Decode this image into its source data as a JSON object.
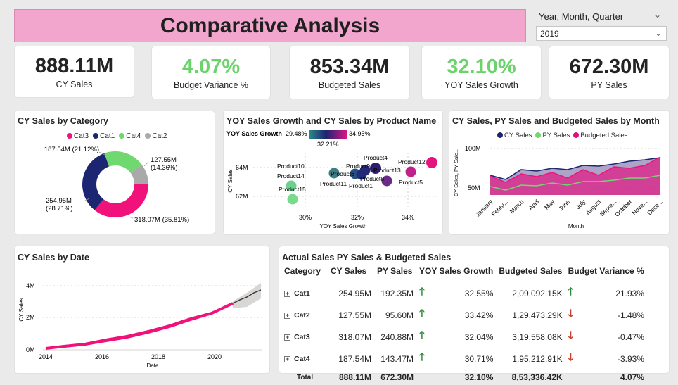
{
  "header": {
    "title": "Comparative Analysis"
  },
  "slicer": {
    "label": "Year, Month, Quarter",
    "value": "2019"
  },
  "kpis": [
    {
      "value": "888.11M",
      "label": "CY Sales"
    },
    {
      "value": "4.07%",
      "label": "Budget Variance %"
    },
    {
      "value": "853.34M",
      "label": "Budgeted Sales"
    },
    {
      "value": "32.10%",
      "label": "YOY Sales Growth"
    },
    {
      "value": "672.30M",
      "label": "PY Sales"
    }
  ],
  "colors": {
    "cat3": "#f0117a",
    "cat1": "#1c2571",
    "cat4": "#6fd86f",
    "cat2": "#a9a9a9",
    "accent": "#e73d8d",
    "up": "#2e8b3d",
    "down": "#c8402e"
  },
  "donut": {
    "title": "CY Sales by Category",
    "legend": [
      "Cat3",
      "Cat1",
      "Cat4",
      "Cat2"
    ],
    "labels": {
      "cat4": "187.54M (21.12%)",
      "cat2_a": "127.55M",
      "cat2_b": "(14.36%)",
      "cat1_a": "254.95M",
      "cat1_b": "(28.71%)",
      "cat3": "318.07M (35.81%)"
    }
  },
  "scatter": {
    "title": "YOY Sales Growth and CY Sales by Product Name",
    "legend_label": "YOY Sales Growth",
    "gradient_min": "29.48%",
    "gradient_mid": "32.21%",
    "gradient_max": "34.95%",
    "ylabel": "CY Sales",
    "xlabel": "YOY Sales Growth",
    "yticks": [
      "64M",
      "62M"
    ],
    "xticks": [
      "30%",
      "32%",
      "34%"
    ],
    "points": [
      "Product10",
      "Product14",
      "Product15",
      "Product11",
      "Product6",
      "Product9",
      "Product1",
      "Product4",
      "Product13",
      "Product8",
      "Product5",
      "Product12"
    ]
  },
  "monthly": {
    "title": "CY Sales, PY Sales and Budgeted Sales by Month",
    "legend": [
      "CY Sales",
      "PY Sales",
      "Budgeted Sales"
    ],
    "ylabel": "CY Sales, PY Sale...",
    "xlabel": "Month",
    "yticks": [
      "100M",
      "50M"
    ],
    "months": [
      "January",
      "Febru...",
      "March",
      "April",
      "May",
      "June",
      "July",
      "August",
      "Septe...",
      "October",
      "Nove...",
      "Dece..."
    ]
  },
  "date_chart": {
    "title": "CY Sales by Date",
    "ylabel": "CY Sales",
    "xlabel": "Date",
    "yticks": [
      "4M",
      "2M",
      "0M"
    ],
    "xticks": [
      "2014",
      "2016",
      "2018",
      "2020"
    ]
  },
  "table": {
    "title": "Actual Sales PY Sales & Budgeted Sales",
    "headers": [
      "Category",
      "CY Sales",
      "PY Sales",
      "YOY Sales Growth",
      "Budgeted Sales",
      "Budget Variance %"
    ],
    "rows": [
      {
        "cat": "Cat1",
        "cy": "254.95M",
        "py": "192.35M",
        "yoy": "32.55%",
        "budget": "2,09,092.15K",
        "var": "21.93%"
      },
      {
        "cat": "Cat2",
        "cy": "127.55M",
        "py": "95.60M",
        "yoy": "33.42%",
        "budget": "1,29,473.29K",
        "var": "-1.48%"
      },
      {
        "cat": "Cat3",
        "cy": "318.07M",
        "py": "240.88M",
        "yoy": "32.04%",
        "budget": "3,19,558.08K",
        "var": "-0.47%"
      },
      {
        "cat": "Cat4",
        "cy": "187.54M",
        "py": "143.47M",
        "yoy": "30.71%",
        "budget": "1,95,212.91K",
        "var": "-3.93%"
      }
    ],
    "total": {
      "cat": "Total",
      "cy": "888.11M",
      "py": "672.30M",
      "yoy": "32.10%",
      "budget": "8,53,336.42K",
      "var": "4.07%"
    }
  }
}
